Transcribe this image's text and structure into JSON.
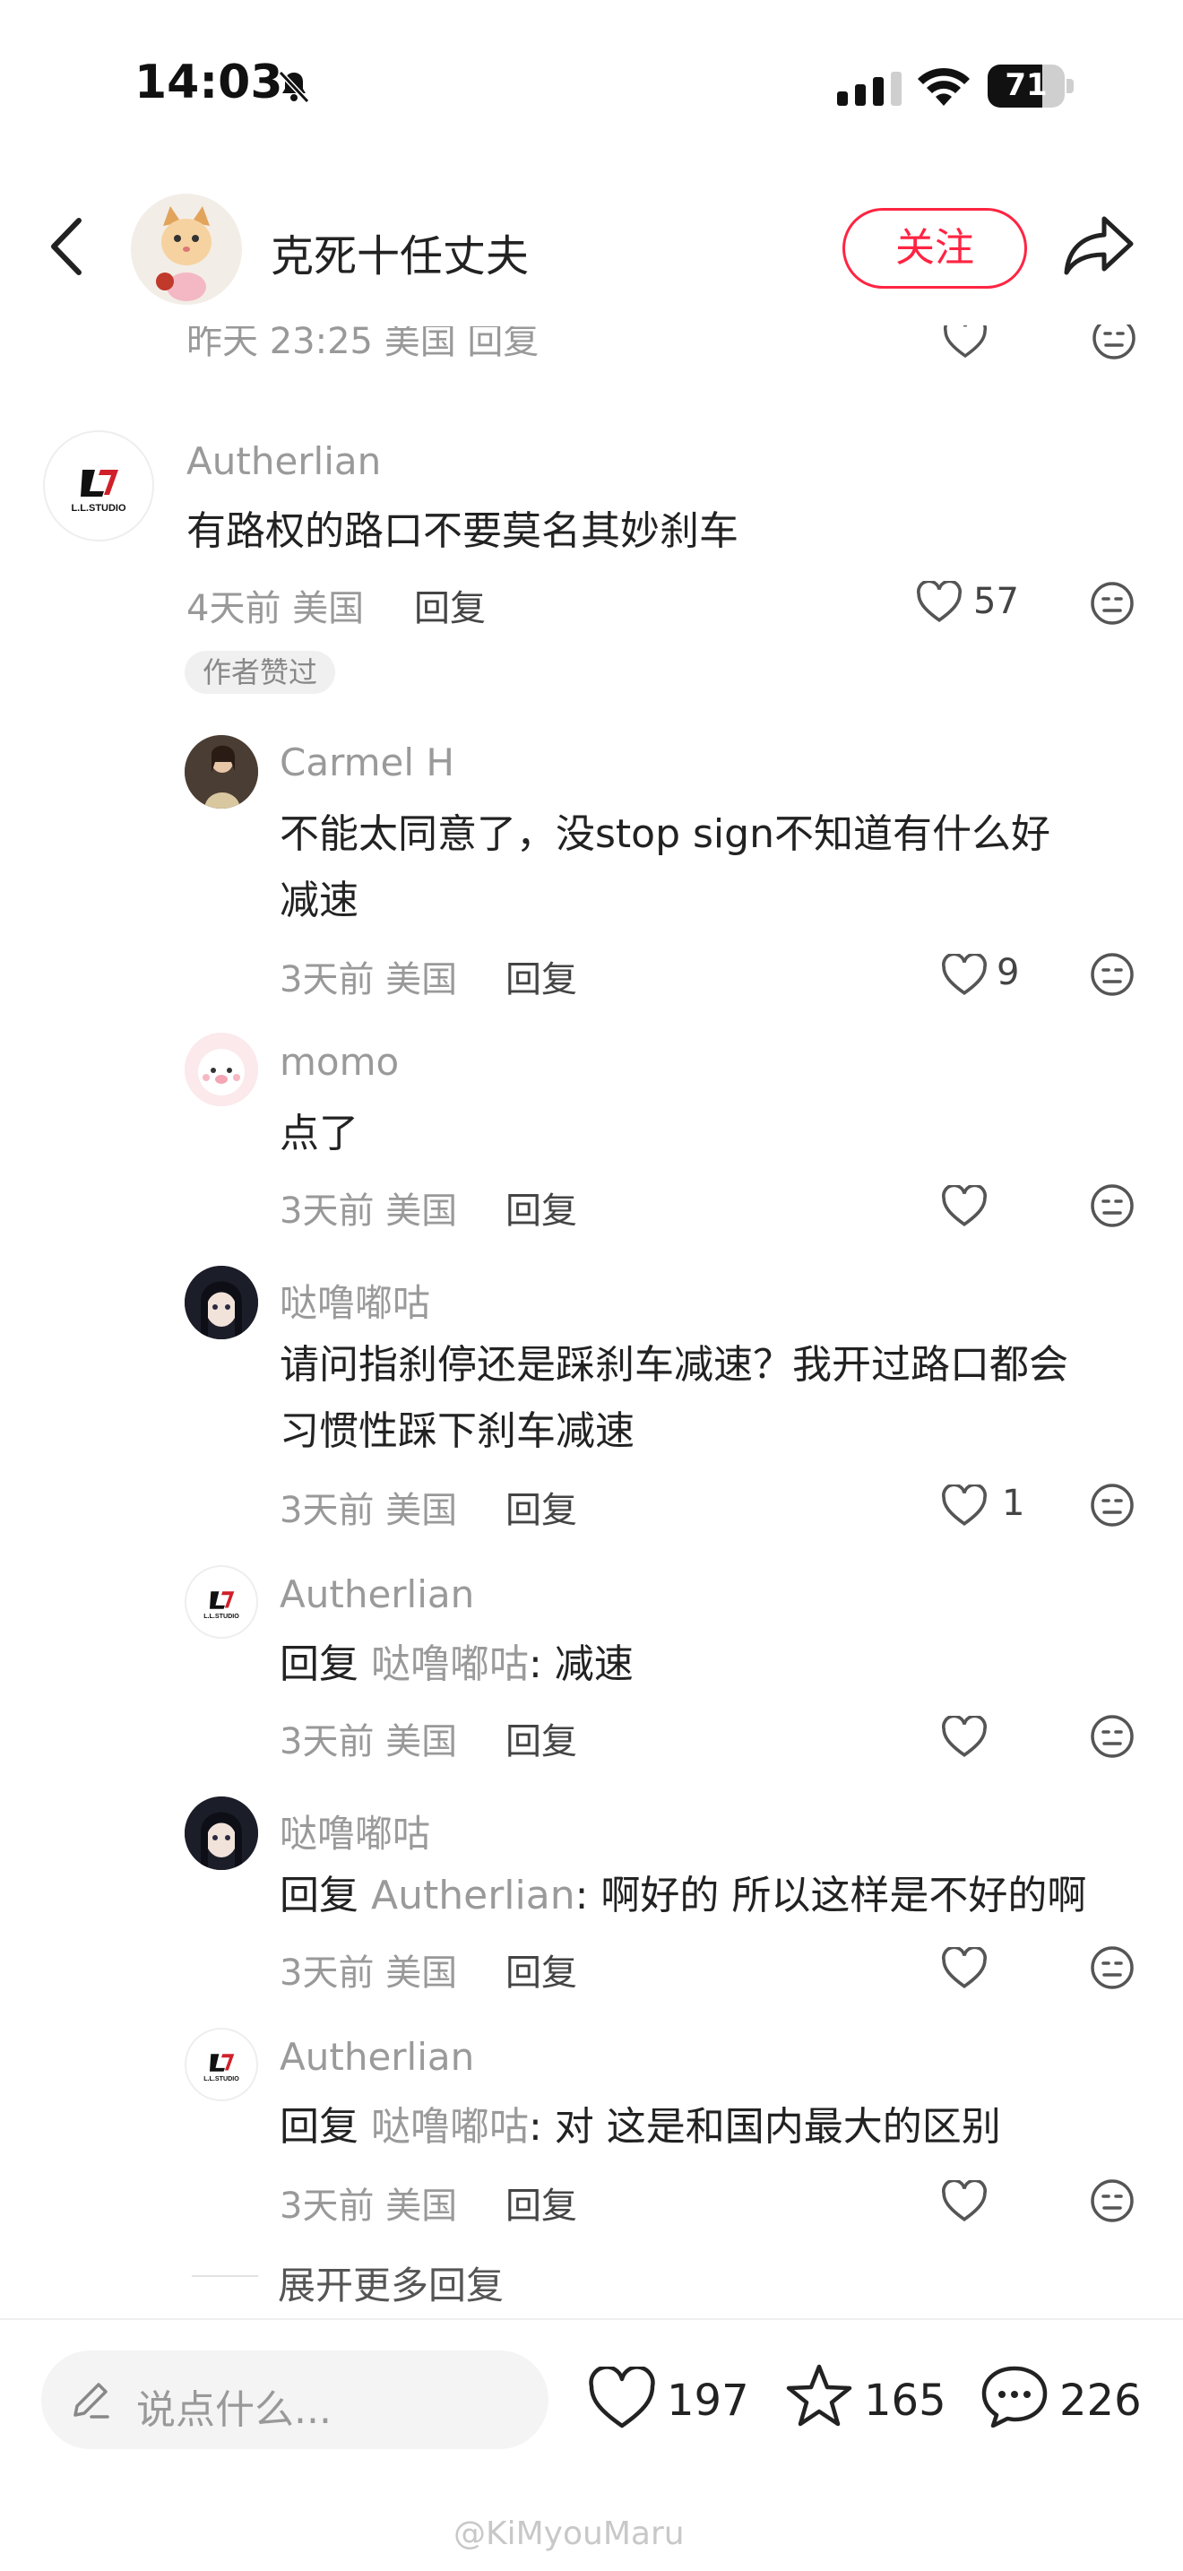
{
  "status": {
    "time": "14:03",
    "battery": "71",
    "battery_level": 0.71
  },
  "header": {
    "title": "克死十任丈夫",
    "follow_label": "关注"
  },
  "cut_comment": {
    "meta": "昨天 23:25 美国 回复"
  },
  "comment_main": {
    "user": "Autherlian",
    "text": "有路权的路口不要莫名其妙刹车",
    "meta": "4天前 美国",
    "reply": "回复",
    "likes": "57",
    "badge": "作者赞过"
  },
  "replies": [
    {
      "user": "Carmel H",
      "text1": "不能太同意了，没stop sign不知道有什么好",
      "text2": "减速",
      "meta": "3天前 美国",
      "reply": "回复",
      "likes": "9"
    },
    {
      "user": "momo",
      "text1": "点了",
      "meta": "3天前 美国",
      "reply": "回复"
    },
    {
      "user": "哒噜嘟咕",
      "text1": "请问指刹停还是踩刹车减速？我开过路口都会",
      "text2": "习惯性踩下刹车减速",
      "meta": "3天前 美国",
      "reply": "回复",
      "likes": "1"
    },
    {
      "user": "Autherlian",
      "prefix": "回复",
      "target": "哒噜嘟咕",
      "rest": ": 减速",
      "meta": "3天前 美国",
      "reply": "回复"
    },
    {
      "user": "哒噜嘟咕",
      "prefix": "回复",
      "target": "Autherlian",
      "rest": ": 啊好的 所以这样是不好的啊",
      "meta": "3天前 美国",
      "reply": "回复"
    },
    {
      "user": "Autherlian",
      "prefix": "回复",
      "target": "哒噜嘟咕",
      "rest": ": 对 这是和国内最大的区别",
      "meta": "3天前 美国",
      "reply": "回复"
    }
  ],
  "expand_label": "展开更多回复",
  "bottom": {
    "placeholder": "说点什么...",
    "likes": "197",
    "stars": "165",
    "comments": "226"
  },
  "watermark": "@KiMyouMaru",
  "colors": {
    "accent": "#ff2442",
    "muted": "#999999"
  }
}
